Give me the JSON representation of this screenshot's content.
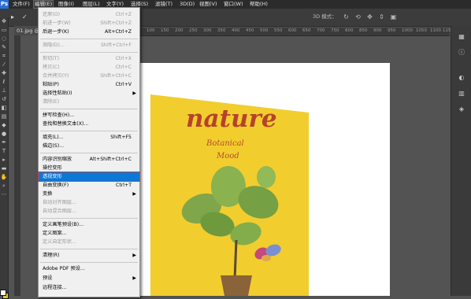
{
  "app": {
    "logo": "Ps"
  },
  "menubar": {
    "items": [
      {
        "label": "文件(F)"
      },
      {
        "label": "编辑(E)"
      },
      {
        "label": "图像(I)"
      },
      {
        "label": "图层(L)"
      },
      {
        "label": "文字(Y)"
      },
      {
        "label": "选择(S)"
      },
      {
        "label": "滤镜(T)"
      },
      {
        "label": "3D(D)"
      },
      {
        "label": "视图(V)"
      },
      {
        "label": "窗口(W)"
      },
      {
        "label": "帮助(H)"
      }
    ]
  },
  "options": {
    "mode_label": "3D 模式："
  },
  "document": {
    "tab_label": "01.jpg @"
  },
  "ruler": {
    "ticks": [
      "100",
      "150",
      "200",
      "250",
      "300",
      "350",
      "400",
      "450",
      "500",
      "550",
      "600",
      "650",
      "700",
      "750",
      "800",
      "850",
      "900",
      "950",
      "1000",
      "1050",
      "1100",
      "115"
    ]
  },
  "edit_menu": {
    "items": [
      {
        "label": "还原(O)",
        "shortcut": "Ctrl+Z",
        "disabled": true
      },
      {
        "label": "前进一步(W)",
        "shortcut": "Shift+Ctrl+Z",
        "disabled": true
      },
      {
        "label": "后退一步(K)",
        "shortcut": "Alt+Ctrl+Z"
      },
      {
        "label": "渐隐(D)...",
        "shortcut": "Shift+Ctrl+F",
        "disabled": true
      },
      {
        "label": "剪切(T)",
        "shortcut": "Ctrl+X",
        "disabled": true
      },
      {
        "label": "拷贝(C)",
        "shortcut": "Ctrl+C",
        "disabled": true
      },
      {
        "label": "合并拷贝(Y)",
        "shortcut": "Shift+Ctrl+C",
        "disabled": true
      },
      {
        "label": "粘贴(P)",
        "shortcut": "Ctrl+V"
      },
      {
        "label": "选择性粘贴(I)",
        "submenu": true
      },
      {
        "label": "清除(E)",
        "disabled": true
      },
      {
        "label": "拼写检查(H)..."
      },
      {
        "label": "查找和替换文本(X)..."
      },
      {
        "label": "填充(L)...",
        "shortcut": "Shift+F5"
      },
      {
        "label": "描边(S)..."
      },
      {
        "label": "内容识别缩放",
        "shortcut": "Alt+Shift+Ctrl+C"
      },
      {
        "label": "操控变形"
      },
      {
        "label": "透视变形",
        "highlighted": true
      },
      {
        "label": "自由变换(F)",
        "shortcut": "Ctrl+T"
      },
      {
        "label": "变换",
        "submenu": true
      },
      {
        "label": "自动对齐图层...",
        "disabled": true
      },
      {
        "label": "自动混合图层...",
        "disabled": true
      },
      {
        "label": "定义画笔预设(B)..."
      },
      {
        "label": "定义图案..."
      },
      {
        "label": "定义自定形状...",
        "disabled": true
      },
      {
        "label": "清理(R)",
        "submenu": true
      },
      {
        "label": "Adobe PDF 预设..."
      },
      {
        "label": "预设",
        "submenu": true
      },
      {
        "label": "远程连接..."
      }
    ]
  },
  "artwork": {
    "title": "nature",
    "subtitle_line1": "Botanical",
    "subtitle_line2": "Mood",
    "background_color": "#f2cd2e",
    "text_color": "#b6422b"
  },
  "colors": {
    "highlight": "#0a78d7",
    "highlight_border": "#e03a2f"
  }
}
